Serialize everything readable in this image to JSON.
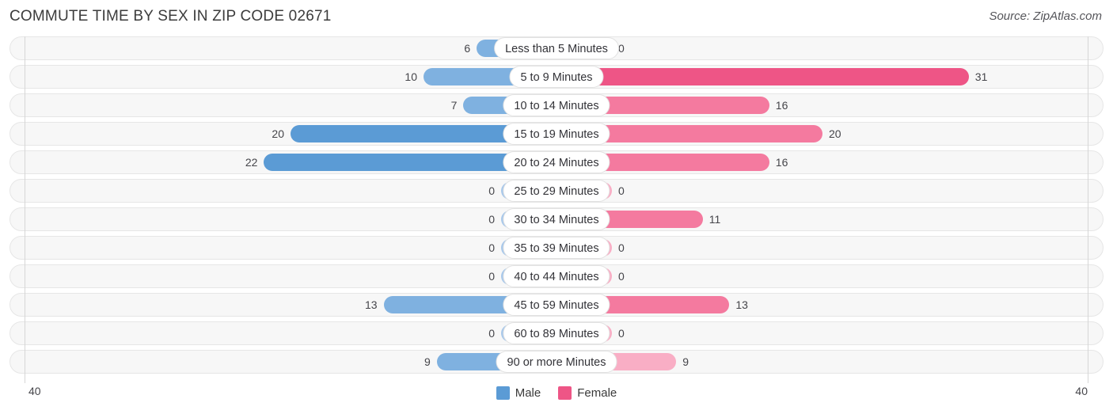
{
  "header": {
    "title": "COMMUTE TIME BY SEX IN ZIP CODE 02671",
    "source": "Source: ZipAtlas.com"
  },
  "axis": {
    "left_cap": "40",
    "right_cap": "40",
    "max": 40
  },
  "legend": {
    "items": [
      {
        "label": "Male",
        "color": "#5b9bd5"
      },
      {
        "label": "Female",
        "color": "#ee5586"
      }
    ]
  },
  "colors": {
    "male_strong": "#5b9bd5",
    "male_mid": "#7fb1e0",
    "male_light": "#a8c8ea",
    "female_strong": "#ee5586",
    "female_mid": "#f47a9f",
    "female_light": "#f9aec5",
    "track_fill": "#f7f7f7",
    "track_border": "#e6e6e6",
    "axis_line": "#d6d6d6"
  },
  "chart_data": {
    "type": "bar",
    "title": "COMMUTE TIME BY SEX IN ZIP CODE 02671",
    "subtitle": "",
    "orientation": "horizontal-diverging",
    "xlabel": "",
    "ylabel": "",
    "xlim": [
      40,
      40
    ],
    "grid": false,
    "legend_position": "bottom-center",
    "categories": [
      "Less than 5 Minutes",
      "5 to 9 Minutes",
      "10 to 14 Minutes",
      "15 to 19 Minutes",
      "20 to 24 Minutes",
      "25 to 29 Minutes",
      "30 to 34 Minutes",
      "35 to 39 Minutes",
      "40 to 44 Minutes",
      "45 to 59 Minutes",
      "60 to 89 Minutes",
      "90 or more Minutes"
    ],
    "series": [
      {
        "name": "Male",
        "values": [
          6,
          10,
          7,
          20,
          22,
          0,
          0,
          0,
          0,
          13,
          0,
          9
        ]
      },
      {
        "name": "Female",
        "values": [
          0,
          31,
          16,
          20,
          16,
          0,
          11,
          0,
          0,
          13,
          0,
          9
        ]
      }
    ]
  },
  "rows": [
    {
      "label": "Less than 5 Minutes",
      "male": "6",
      "female": "0",
      "male_value": 6,
      "female_value": 0
    },
    {
      "label": "5 to 9 Minutes",
      "male": "10",
      "female": "31",
      "male_value": 10,
      "female_value": 31
    },
    {
      "label": "10 to 14 Minutes",
      "male": "7",
      "female": "16",
      "male_value": 7,
      "female_value": 16
    },
    {
      "label": "15 to 19 Minutes",
      "male": "20",
      "female": "20",
      "male_value": 20,
      "female_value": 20
    },
    {
      "label": "20 to 24 Minutes",
      "male": "22",
      "female": "16",
      "male_value": 22,
      "female_value": 16
    },
    {
      "label": "25 to 29 Minutes",
      "male": "0",
      "female": "0",
      "male_value": 0,
      "female_value": 0
    },
    {
      "label": "30 to 34 Minutes",
      "male": "0",
      "female": "11",
      "male_value": 0,
      "female_value": 11
    },
    {
      "label": "35 to 39 Minutes",
      "male": "0",
      "female": "0",
      "male_value": 0,
      "female_value": 0
    },
    {
      "label": "40 to 44 Minutes",
      "male": "0",
      "female": "0",
      "male_value": 0,
      "female_value": 0
    },
    {
      "label": "45 to 59 Minutes",
      "male": "13",
      "female": "13",
      "male_value": 13,
      "female_value": 13
    },
    {
      "label": "60 to 89 Minutes",
      "male": "0",
      "female": "0",
      "male_value": 0,
      "female_value": 0
    },
    {
      "label": "90 or more Minutes",
      "male": "9",
      "female": "9",
      "male_value": 9,
      "female_value": 9
    }
  ]
}
